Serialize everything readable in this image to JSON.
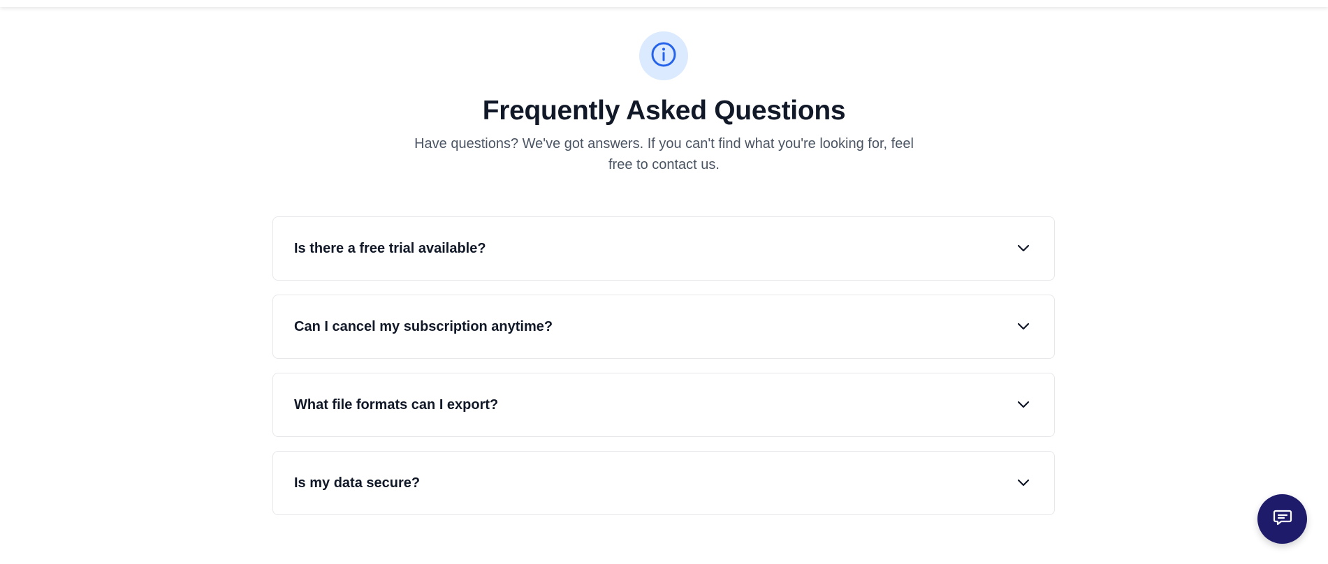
{
  "header": {
    "icon": "info-icon",
    "title": "Frequently Asked Questions",
    "subtitle": "Have questions? We've got answers. If you can't find what you're looking for, feel free to contact us."
  },
  "faq": {
    "items": [
      {
        "question": "Is there a free trial available?",
        "expanded": false
      },
      {
        "question": "Can I cancel my subscription anytime?",
        "expanded": false
      },
      {
        "question": "What file formats can I export?",
        "expanded": false
      },
      {
        "question": "Is my data secure?",
        "expanded": false
      }
    ],
    "toggle_icon": "chevron-down-icon"
  },
  "chat": {
    "icon": "chat-bubble-icon"
  },
  "colors": {
    "accent": "#2563eb",
    "badge_bg": "#dbeafe",
    "chat_bg": "#1e1b6b",
    "title": "#111827",
    "subtitle": "#4b5563",
    "border": "#e5e7eb"
  }
}
